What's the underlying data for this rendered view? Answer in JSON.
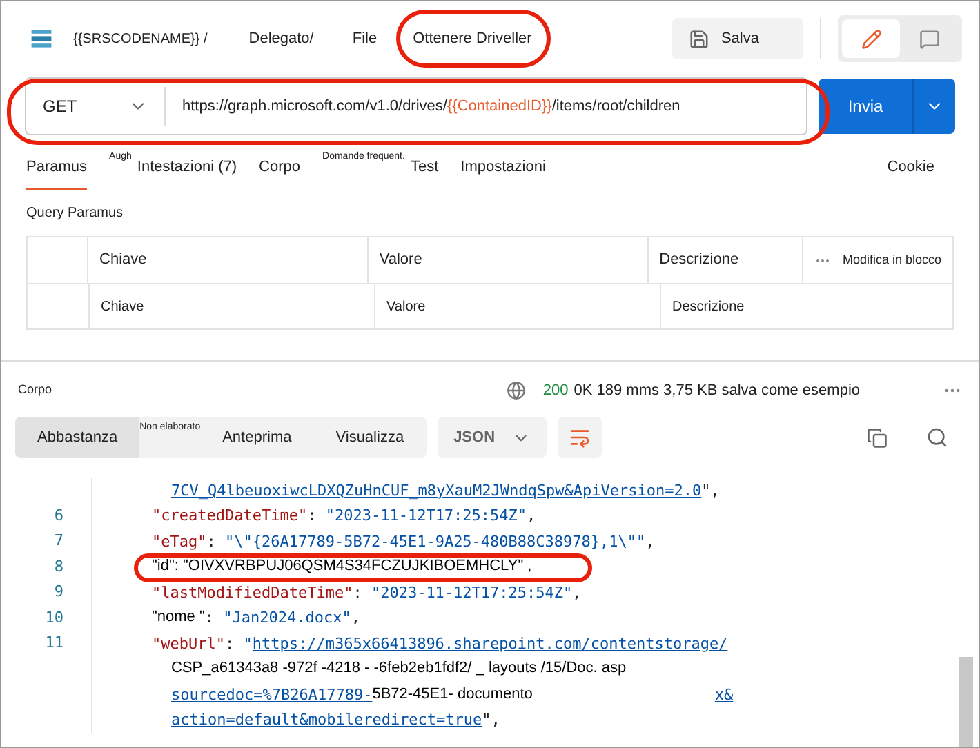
{
  "header": {
    "breadcrumb": [
      "{{SRSCODENAME}} /",
      "Delegato/",
      "File"
    ],
    "request_name": "Ottenere Driveller",
    "save_label": "Salva",
    "mode_buttons": [
      {
        "kind": "edit",
        "selected": true
      },
      {
        "kind": "comment",
        "selected": false
      }
    ]
  },
  "request": {
    "method": "GET",
    "url_parts": [
      {
        "kind": "text",
        "text": "https://graph.microsoft.com/v1.0/drives/"
      },
      {
        "kind": "var",
        "text": "{{ContainedID}}"
      },
      {
        "kind": "text",
        "text": "/items/root/children"
      }
    ],
    "send_label": "Invia"
  },
  "tabs": [
    {
      "label": "Paramus",
      "kind": "main",
      "selected": true
    },
    {
      "label": "Augh",
      "kind": "raised",
      "selected": false
    },
    {
      "label": "Intestazioni (7)",
      "kind": "main",
      "selected": false
    },
    {
      "label": "Corpo",
      "kind": "main",
      "selected": false
    },
    {
      "label": "Domande frequent.",
      "kind": "raised",
      "selected": false
    },
    {
      "label": "Test",
      "kind": "main",
      "selected": false
    },
    {
      "label": "Impostazioni",
      "kind": "main",
      "selected": false
    }
  ],
  "cookie_label": "Cookie",
  "query": {
    "title": "Query Paramus",
    "columns": [
      "Chiave",
      "Valore",
      "Descrizione"
    ],
    "bulk_edit": "Modifica in blocco",
    "placeholder_row": [
      "Chiave",
      "Valore",
      "Descrizione"
    ]
  },
  "response": {
    "title": "Corpo",
    "status_code": "200",
    "status_text": "0K 189 mms 3,75 KB salva come esempio",
    "views": [
      {
        "label": "Abbastanza",
        "kind": "main",
        "selected": true
      },
      {
        "label": "Non elaborato",
        "kind": "raised",
        "selected": false
      },
      {
        "label": "Anteprima",
        "kind": "main",
        "selected": false
      },
      {
        "label": "Visualizza",
        "kind": "main",
        "selected": false
      }
    ],
    "format": "JSON",
    "lines": [
      {
        "segments": [
          {
            "kind": "link",
            "text": "7CV_Q4lbeuoxiwcLDXQZuHnCUF_m8yXauM2JWndqSpw&ApiVersion=2.0"
          },
          {
            "kind": "punct",
            "text": "\","
          }
        ]
      },
      {
        "number": "6",
        "segments": [
          {
            "kind": "key",
            "text": "\"createdDateTime\""
          },
          {
            "kind": "punct",
            "text": ": "
          },
          {
            "kind": "str",
            "text": "\"2023-11-12T17:25:54Z\""
          },
          {
            "kind": "punct",
            "text": ","
          }
        ]
      },
      {
        "number": "7",
        "segments": [
          {
            "kind": "key",
            "text": "\"eTag\""
          },
          {
            "kind": "punct",
            "text": ": "
          },
          {
            "kind": "str",
            "text": "\"\\\"{26A17789-5B72-45E1-9A25-480B88C38978},1\\\"\""
          },
          {
            "kind": "punct",
            "text": ","
          }
        ]
      },
      {
        "number": "8",
        "segments": [
          {
            "kind": "plain",
            "text": "\"id\": \"OIVXVRBPUJ06QSM4S34FCZUJKIBOEMHCLY\" ,"
          }
        ]
      },
      {
        "number": "9",
        "segments": [
          {
            "kind": "key",
            "text": "\"lastModifiedDateTime\""
          },
          {
            "kind": "punct",
            "text": ": "
          },
          {
            "kind": "str",
            "text": "\"2023-11-12T17:25:54Z\""
          },
          {
            "kind": "punct",
            "text": ","
          }
        ]
      },
      {
        "number": "10",
        "segments": [
          {
            "kind": "plain",
            "text": "\"nome \""
          },
          {
            "kind": "punct",
            "text": ": "
          },
          {
            "kind": "str",
            "text": "\"Jan2024.docx\""
          },
          {
            "kind": "punct",
            "text": ","
          }
        ]
      },
      {
        "number": "11",
        "segments": [
          {
            "kind": "key",
            "text": "\"webUrl\""
          },
          {
            "kind": "punct",
            "text": ": "
          },
          {
            "kind": "str",
            "text": "\""
          },
          {
            "kind": "link",
            "text": "https://m365x66413896.sharepoint.com/contentstorage/"
          }
        ]
      },
      {
        "segments": [
          {
            "kind": "plain",
            "text": "CSP_a61343a8 -972f -4218 - -6feb2eb1fdf2/ _ layouts /15/Doc. asp"
          }
        ]
      },
      {
        "segments": [
          {
            "kind": "link",
            "text": "sourcedoc=%7B26A17789-"
          },
          {
            "kind": "plain",
            "text": "5B72-45E1- documento"
          }
        ],
        "trailing": [
          {
            "kind": "link",
            "text": "x&"
          }
        ]
      },
      {
        "segments": [
          {
            "kind": "link",
            "text": "action=default&mobileredirect=true"
          },
          {
            "kind": "punct",
            "text": "\","
          }
        ]
      }
    ]
  }
}
